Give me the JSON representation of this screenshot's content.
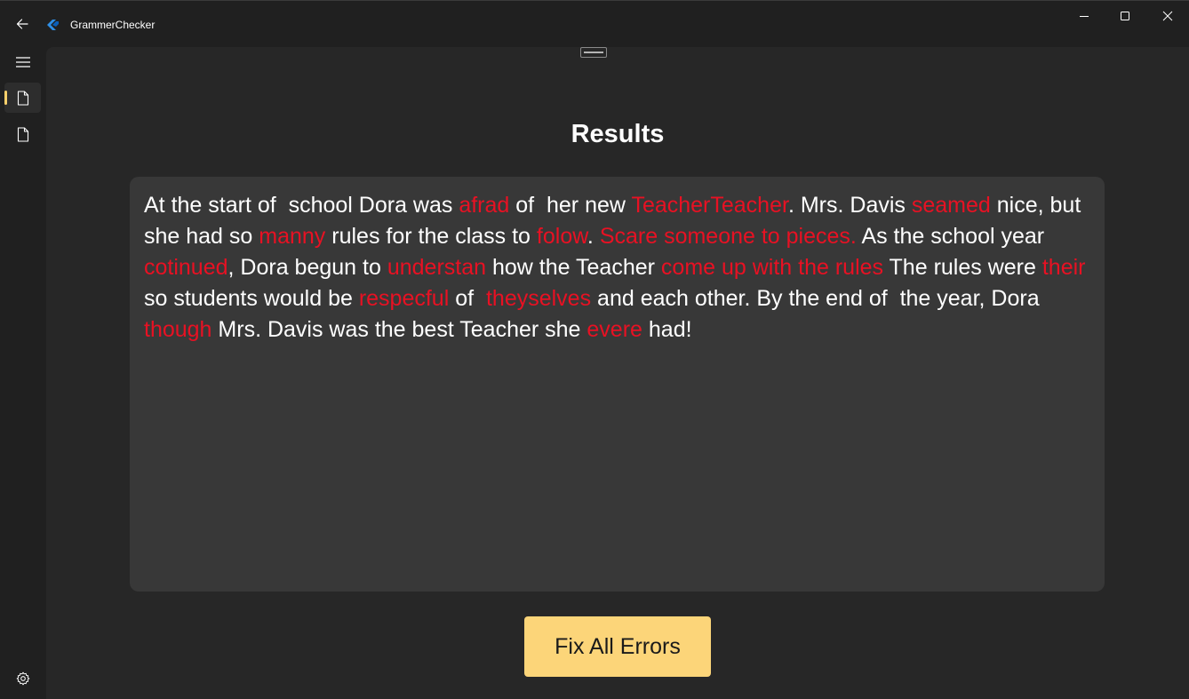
{
  "app": {
    "title": "GrammerChecker"
  },
  "titlebar": {
    "back_icon": "arrow-left-icon",
    "minimize_icon": "minimize-icon",
    "maximize_icon": "maximize-icon",
    "close_icon": "close-icon"
  },
  "nav": {
    "menu_icon": "hamburger-icon",
    "items": [
      {
        "icon": "document-icon",
        "selected": true
      },
      {
        "icon": "document-icon",
        "selected": false
      }
    ],
    "settings_icon": "gear-icon",
    "indicator_color": "#f9d06b"
  },
  "results": {
    "title": "Results",
    "segments": [
      {
        "text": "At the start of  school Dora was ",
        "error": false
      },
      {
        "text": "afrad",
        "error": true
      },
      {
        "text": " of  her new ",
        "error": false
      },
      {
        "text": "TeacherTeacher",
        "error": true
      },
      {
        "text": ". Mrs. Davis ",
        "error": false
      },
      {
        "text": "seamed",
        "error": true
      },
      {
        "text": " nice, but she had so ",
        "error": false
      },
      {
        "text": "manny",
        "error": true
      },
      {
        "text": " rules for the class to ",
        "error": false
      },
      {
        "text": "folow",
        "error": true
      },
      {
        "text": ". ",
        "error": false
      },
      {
        "text": "Scare someone to pieces.",
        "error": true
      },
      {
        "text": " As the school year ",
        "error": false
      },
      {
        "text": "cotinued",
        "error": true
      },
      {
        "text": ", Dora begun to ",
        "error": false
      },
      {
        "text": "understan",
        "error": true
      },
      {
        "text": " how the Teacher ",
        "error": false
      },
      {
        "text": "come up with the rules",
        "error": true
      },
      {
        "text": " The rules were ",
        "error": false
      },
      {
        "text": "their",
        "error": true
      },
      {
        "text": " so students would be ",
        "error": false
      },
      {
        "text": "respecful",
        "error": true
      },
      {
        "text": " of  ",
        "error": false
      },
      {
        "text": "theyselves",
        "error": true
      },
      {
        "text": " and each other. By the end of  the year, Dora ",
        "error": false
      },
      {
        "text": "though",
        "error": true
      },
      {
        "text": " Mrs. Davis was the best Teacher she ",
        "error": false
      },
      {
        "text": "evere",
        "error": true
      },
      {
        "text": " had!",
        "error": false
      }
    ],
    "error_color": "#e81123"
  },
  "actions": {
    "fix_all_label": "Fix All Errors",
    "accent_color": "#fcd579"
  }
}
